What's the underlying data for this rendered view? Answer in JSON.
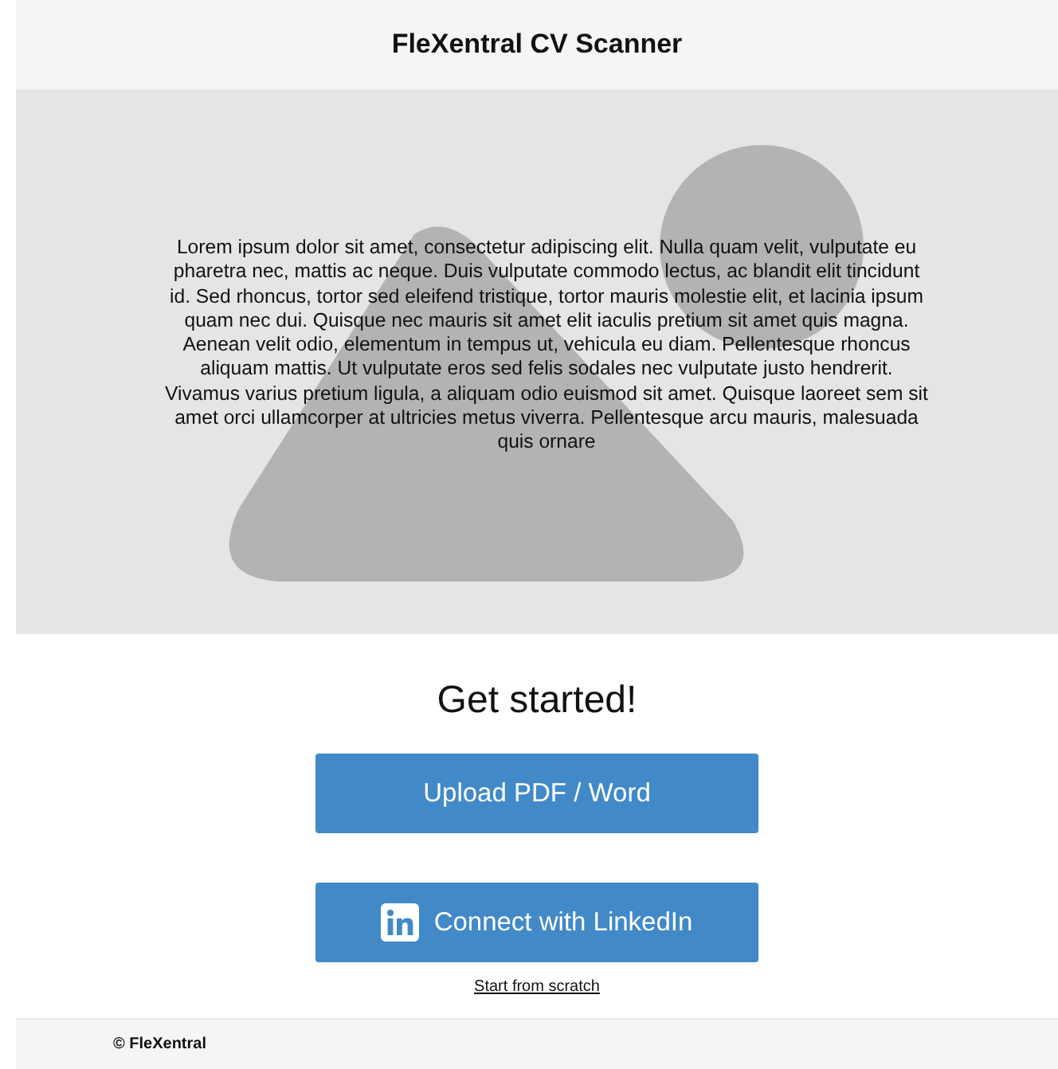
{
  "header": {
    "title": "FleXentral CV Scanner"
  },
  "hero": {
    "text": "Lorem ipsum dolor sit amet, consectetur adipiscing elit. Nulla quam velit, vulputate eu pharetra nec, mattis ac neque. Duis vulputate commodo lectus, ac blandit elit tincidunt id. Sed rhoncus, tortor sed eleifend tristique, tortor mauris molestie elit, et lacinia ipsum quam nec dui. Quisque nec mauris sit amet elit iaculis pretium sit amet quis magna. Aenean velit odio, elementum in tempus ut, vehicula eu diam. Pellentesque rhoncus aliquam mattis. Ut vulputate eros sed felis sodales nec vulputate justo hendrerit. Vivamus varius pretium ligula, a aliquam odio euismod sit amet. Quisque laoreet sem sit amet orci ullamcorper at ultricies metus viverra. Pellentesque arcu mauris, malesuada quis ornare"
  },
  "heading": "Get started!",
  "buttons": [
    {
      "kind": "upload",
      "label": "Upload PDF / Word"
    },
    {
      "kind": "linkedin",
      "label": "Connect with LinkedIn"
    }
  ],
  "link": "Start from scratch",
  "footer": "© FleXentral"
}
